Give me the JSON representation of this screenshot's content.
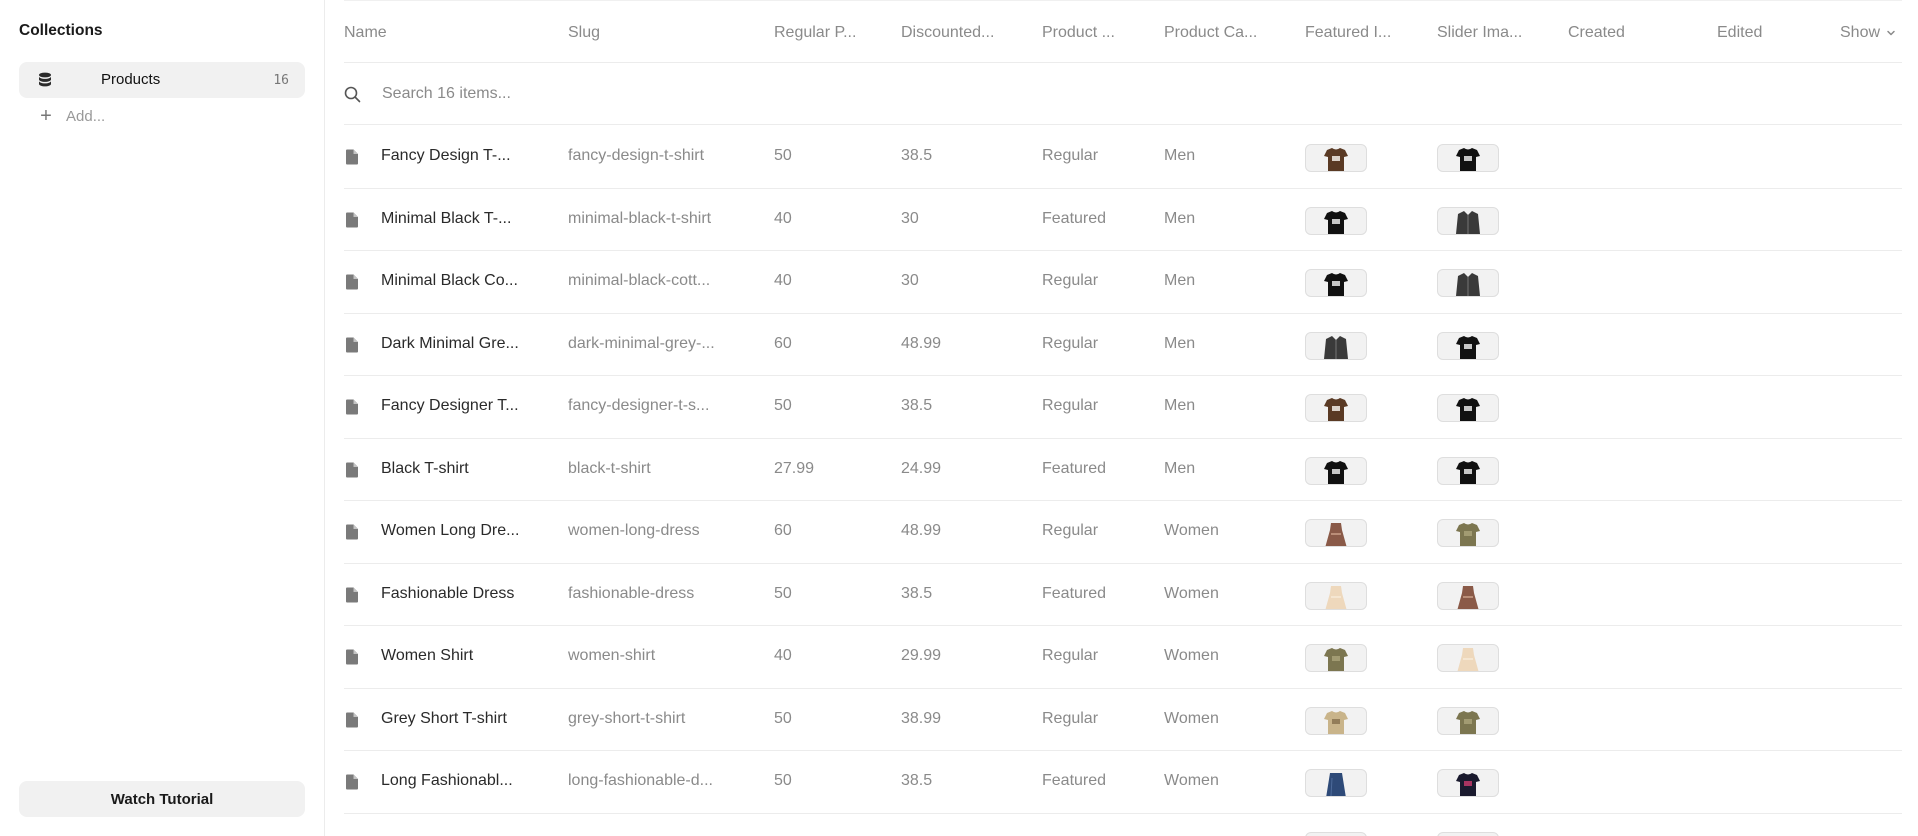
{
  "sidebar": {
    "heading": "Collections",
    "items": [
      {
        "label": "Products",
        "count": "16"
      }
    ],
    "add_label": "Add...",
    "tutorial_label": "Watch Tutorial"
  },
  "table": {
    "columns": {
      "name": "Name",
      "slug": "Slug",
      "regular_price": "Regular P...",
      "discounted_price": "Discounted...",
      "product_type": "Product ...",
      "product_category": "Product Ca...",
      "featured_image": "Featured I...",
      "slider_image": "Slider Ima...",
      "created": "Created",
      "edited": "Edited",
      "show": "Show"
    },
    "search_placeholder": "Search 16 items...",
    "rows": [
      {
        "name": "Fancy Design T-...",
        "slug": "fancy-design-t-shirt",
        "regular_price": "50",
        "discounted_price": "38.5",
        "product_type": "Regular",
        "product_category": "Men",
        "featured_thumb": "brown-print-tshirt",
        "slider_thumb": "black-tshirt"
      },
      {
        "name": "Minimal Black T-...",
        "slug": "minimal-black-t-shirt",
        "regular_price": "40",
        "discounted_price": "30",
        "product_type": "Featured",
        "product_category": "Men",
        "featured_thumb": "black-tshirt",
        "slider_thumb": "grey-jacket"
      },
      {
        "name": "Minimal Black Co...",
        "slug": "minimal-black-cott...",
        "regular_price": "40",
        "discounted_price": "30",
        "product_type": "Regular",
        "product_category": "Men",
        "featured_thumb": "black-tshirt",
        "slider_thumb": "grey-jacket"
      },
      {
        "name": "Dark Minimal Gre...",
        "slug": "dark-minimal-grey-...",
        "regular_price": "60",
        "discounted_price": "48.99",
        "product_type": "Regular",
        "product_category": "Men",
        "featured_thumb": "grey-jacket",
        "slider_thumb": "black-tshirt"
      },
      {
        "name": "Fancy Designer T...",
        "slug": "fancy-designer-t-s...",
        "regular_price": "50",
        "discounted_price": "38.5",
        "product_type": "Regular",
        "product_category": "Men",
        "featured_thumb": "brown-print-tshirt",
        "slider_thumb": "black-tshirt"
      },
      {
        "name": "Black T-shirt",
        "slug": "black-t-shirt",
        "regular_price": "27.99",
        "discounted_price": "24.99",
        "product_type": "Featured",
        "product_category": "Men",
        "featured_thumb": "black-tshirt",
        "slider_thumb": "black-tshirt"
      },
      {
        "name": "Women Long Dre...",
        "slug": "women-long-dress",
        "regular_price": "60",
        "discounted_price": "48.99",
        "product_type": "Regular",
        "product_category": "Women",
        "featured_thumb": "floral-dress",
        "slider_thumb": "olive-blouse"
      },
      {
        "name": "Fashionable Dress",
        "slug": "fashionable-dress",
        "regular_price": "50",
        "discounted_price": "38.5",
        "product_type": "Featured",
        "product_category": "Women",
        "featured_thumb": "beige-dress",
        "slider_thumb": "floral-dress"
      },
      {
        "name": "Women Shirt",
        "slug": "women-shirt",
        "regular_price": "40",
        "discounted_price": "29.99",
        "product_type": "Regular",
        "product_category": "Women",
        "featured_thumb": "olive-blouse",
        "slider_thumb": "beige-dress"
      },
      {
        "name": "Grey Short T-shirt",
        "slug": "grey-short-t-shirt",
        "regular_price": "50",
        "discounted_price": "38.99",
        "product_type": "Regular",
        "product_category": "Women",
        "featured_thumb": "leopard-top",
        "slider_thumb": "olive-blouse"
      },
      {
        "name": "Long Fashionabl...",
        "slug": "long-fashionable-d...",
        "regular_price": "50",
        "discounted_price": "38.5",
        "product_type": "Featured",
        "product_category": "Women",
        "featured_thumb": "denim-skirt",
        "slider_thumb": "navy-print-tshirt"
      },
      {
        "name": "",
        "slug": "",
        "regular_price": "",
        "discounted_price": "",
        "product_type": "",
        "product_category": "",
        "featured_thumb": "black-tshirt",
        "slider_thumb": "denim-skirt"
      }
    ]
  },
  "colors": {
    "accent": "#f1f1f1",
    "border": "#ececec",
    "muted_text": "#8a8a8a",
    "primary_text": "#2a2a2a"
  }
}
